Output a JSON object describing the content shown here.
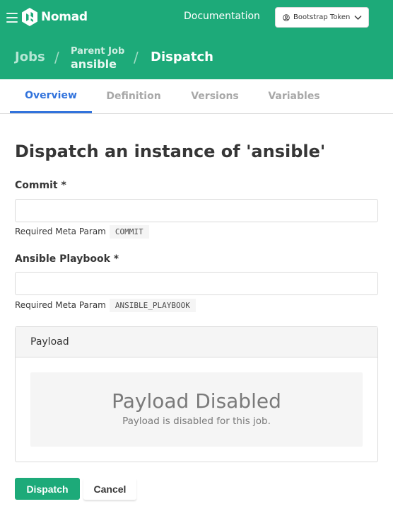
{
  "header": {
    "brand": "Nomad",
    "documentation_link": "Documentation",
    "token_button_label": "Bootstrap Token",
    "brand_color": "#1daa79"
  },
  "breadcrumb": {
    "jobs": "Jobs",
    "separator": "/",
    "parent_label": "Parent Job",
    "parent_name": "ansible",
    "current": "Dispatch"
  },
  "tabs": [
    {
      "label": "Overview",
      "active": true
    },
    {
      "label": "Definition",
      "active": false
    },
    {
      "label": "Versions",
      "active": false
    },
    {
      "label": "Variables",
      "active": false
    }
  ],
  "form": {
    "title": "Dispatch an instance of 'ansible'",
    "required_marker": "*",
    "fields": [
      {
        "label": "Commit",
        "value": "",
        "help_text": "Required Meta Param",
        "param_name": "COMMIT"
      },
      {
        "label": "Ansible Playbook",
        "value": "",
        "help_text": "Required Meta Param",
        "param_name": "ANSIBLE_PLAYBOOK"
      }
    ],
    "payload": {
      "header": "Payload",
      "empty_title": "Payload Disabled",
      "empty_message": "Payload is disabled for this job."
    },
    "actions": {
      "dispatch": "Dispatch",
      "cancel": "Cancel"
    }
  }
}
